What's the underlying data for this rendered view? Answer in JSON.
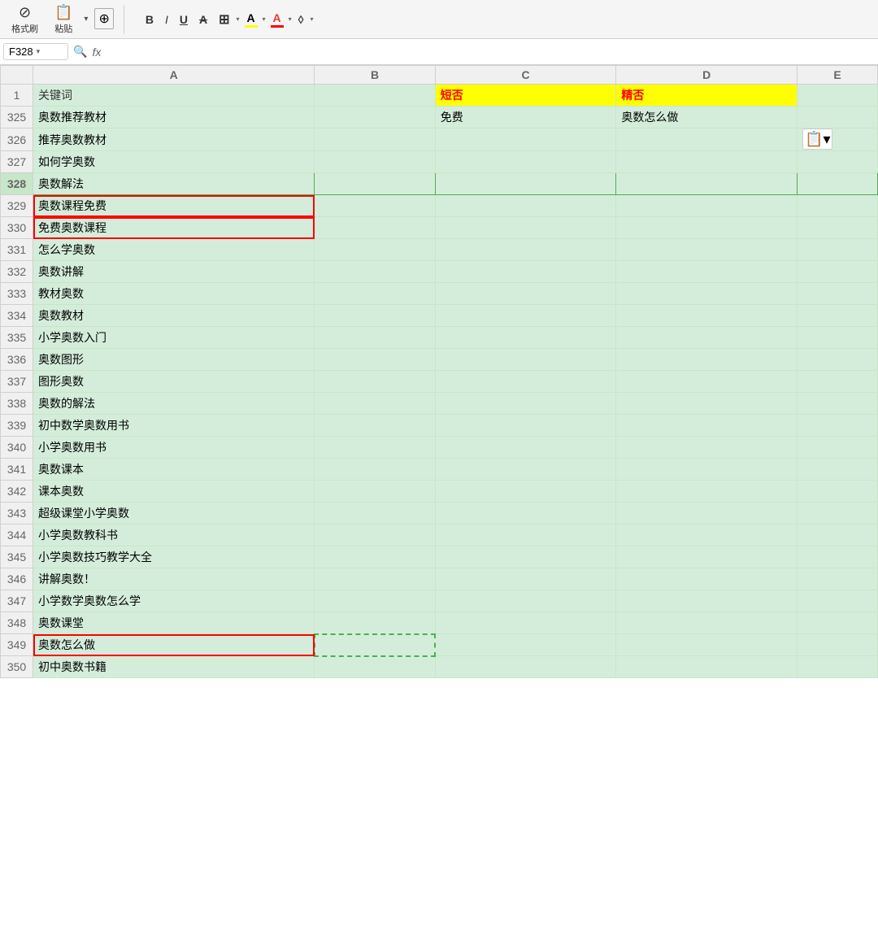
{
  "toolbar": {
    "format_brush_label": "格式刷",
    "paste_label": "粘贴",
    "bold": "B",
    "italic": "I",
    "underline": "U",
    "strikethrough": "A",
    "border_btn": "⊞",
    "highlight_color": "A",
    "font_color": "A",
    "eraser": "◊",
    "cell_ref": "F328",
    "formula_label": "fx"
  },
  "columns": {
    "corner": "",
    "A": "A",
    "B": "B",
    "C": "C",
    "D": "D",
    "E": "E"
  },
  "rows": [
    {
      "num": "1",
      "a": "关键词",
      "b": "",
      "c": "短否",
      "d": "精否",
      "e": "",
      "header": true
    },
    {
      "num": "325",
      "a": "奥数推荐教材",
      "b": "",
      "c": "免费",
      "d": "奥数怎么做",
      "e": ""
    },
    {
      "num": "326",
      "a": "推荐奥数教材",
      "b": "",
      "c": "",
      "d": "",
      "e": "paste_icon"
    },
    {
      "num": "327",
      "a": "如何学奥数",
      "b": "",
      "c": "",
      "d": "",
      "e": ""
    },
    {
      "num": "328",
      "a": "奥数解法",
      "b": "",
      "c": "",
      "d": "",
      "e": "",
      "selected": true
    },
    {
      "num": "329",
      "a": "奥数课程免费",
      "b": "",
      "c": "",
      "d": "",
      "e": "",
      "red_border": true
    },
    {
      "num": "330",
      "a": "免费奥数课程",
      "b": "",
      "c": "",
      "d": "",
      "e": "",
      "red_border": true
    },
    {
      "num": "331",
      "a": "怎么学奥数",
      "b": "",
      "c": "",
      "d": "",
      "e": ""
    },
    {
      "num": "332",
      "a": "奥数讲解",
      "b": "",
      "c": "",
      "d": "",
      "e": ""
    },
    {
      "num": "333",
      "a": "教材奥数",
      "b": "",
      "c": "",
      "d": "",
      "e": ""
    },
    {
      "num": "334",
      "a": "奥数教材",
      "b": "",
      "c": "",
      "d": "",
      "e": ""
    },
    {
      "num": "335",
      "a": "小学奥数入门",
      "b": "",
      "c": "",
      "d": "",
      "e": ""
    },
    {
      "num": "336",
      "a": "奥数图形",
      "b": "",
      "c": "",
      "d": "",
      "e": ""
    },
    {
      "num": "337",
      "a": "图形奥数",
      "b": "",
      "c": "",
      "d": "",
      "e": ""
    },
    {
      "num": "338",
      "a": "奥数的解法",
      "b": "",
      "c": "",
      "d": "",
      "e": ""
    },
    {
      "num": "339",
      "a": "初中数学奥数用书",
      "b": "",
      "c": "",
      "d": "",
      "e": ""
    },
    {
      "num": "340",
      "a": "小学奥数用书",
      "b": "",
      "c": "",
      "d": "",
      "e": ""
    },
    {
      "num": "341",
      "a": "奥数课本",
      "b": "",
      "c": "",
      "d": "",
      "e": ""
    },
    {
      "num": "342",
      "a": "课本奥数",
      "b": "",
      "c": "",
      "d": "",
      "e": ""
    },
    {
      "num": "343",
      "a": "超级课堂小学奥数",
      "b": "",
      "c": "",
      "d": "",
      "e": ""
    },
    {
      "num": "344",
      "a": "小学奥数教科书",
      "b": "",
      "c": "",
      "d": "",
      "e": ""
    },
    {
      "num": "345",
      "a": "小学奥数技巧教学大全",
      "b": "",
      "c": "",
      "d": "",
      "e": ""
    },
    {
      "num": "346",
      "a": "讲解奥数！",
      "b": "",
      "c": "",
      "d": "",
      "e": ""
    },
    {
      "num": "347",
      "a": "小学数学奥数怎么学",
      "b": "",
      "c": "",
      "d": "",
      "e": ""
    },
    {
      "num": "348",
      "a": "奥数课堂",
      "b": "",
      "c": "",
      "d": "",
      "e": ""
    },
    {
      "num": "349",
      "a": "奥数怎么做",
      "b": "",
      "c": "",
      "d": "",
      "e": "",
      "red_border": true,
      "dashed_b": true
    },
    {
      "num": "350",
      "a": "初中奥数书籍",
      "b": "",
      "c": "",
      "d": "",
      "e": ""
    }
  ]
}
